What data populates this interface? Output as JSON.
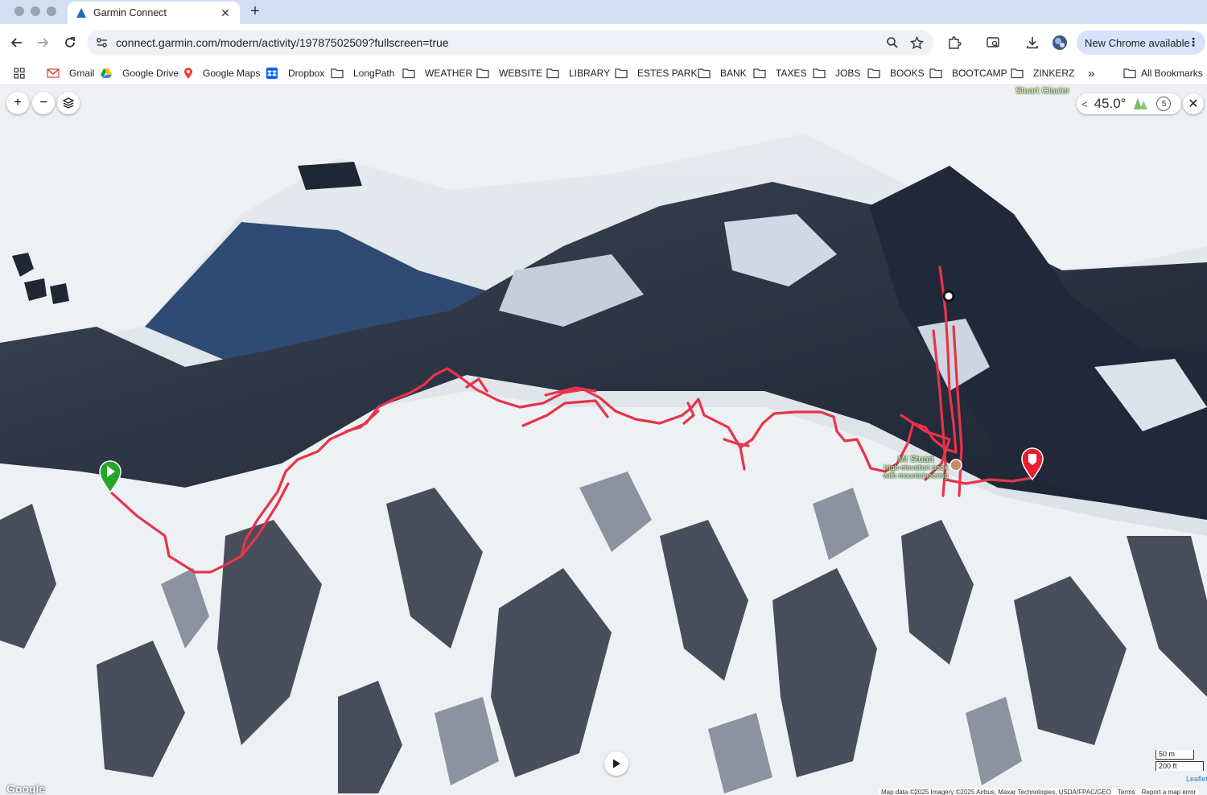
{
  "browser": {
    "tab": {
      "title": "Garmin Connect",
      "close": "✕"
    },
    "new_tab": "+",
    "url": "connect.garmin.com/modern/activity/19787502509?fullscreen=true",
    "update_button": "New Chrome available",
    "update_menu": "⋮",
    "bookmarks": [
      {
        "label": "Gmail",
        "icon": "gmail-icon"
      },
      {
        "label": "Google Drive",
        "icon": "drive-icon"
      },
      {
        "label": "Google Maps",
        "icon": "maps-pin-icon"
      },
      {
        "label": "Dropbox",
        "icon": "dropbox-icon"
      },
      {
        "label": "LongPath",
        "icon": "folder-icon"
      },
      {
        "label": "WEATHER",
        "icon": "folder-icon"
      },
      {
        "label": "WEBSITE",
        "icon": "folder-icon"
      },
      {
        "label": "LIBRARY",
        "icon": "folder-icon"
      },
      {
        "label": "ESTES PARK",
        "icon": "folder-icon"
      },
      {
        "label": "BANK",
        "icon": "folder-icon"
      },
      {
        "label": "TAXES",
        "icon": "folder-icon"
      },
      {
        "label": "JOBS",
        "icon": "folder-icon"
      },
      {
        "label": "BOOKS",
        "icon": "folder-icon"
      },
      {
        "label": "BOOTCAMP",
        "icon": "folder-icon"
      },
      {
        "label": "ZINKERZ",
        "icon": "folder-icon"
      }
    ],
    "bookmarks_overflow": "»",
    "all_bookmarks": "All Bookmarks"
  },
  "map": {
    "zoom_in": "+",
    "zoom_out": "−",
    "tilt_value": "45.0°",
    "tilt_badge": "5",
    "close": "✕",
    "glacier_label": "Stuart Glacier",
    "peak": {
      "name": "Mt Stuart",
      "desc_1": "High-elevation peak",
      "desc_2": "with mountaineering"
    },
    "scale": {
      "metric": "50 m",
      "imperial": "200 ft"
    },
    "leaflet": "Leaflet",
    "google": "Google",
    "attribution": {
      "data": "Map data ©2025 Imagery ©2025 Airbus, Maxar Technologies, USDA/FPAC/GEO",
      "terms": "Terms",
      "report": "Report a map error"
    },
    "track_color": "#e8334a",
    "start_color": "#26a52c",
    "end_color": "#e6202e"
  }
}
